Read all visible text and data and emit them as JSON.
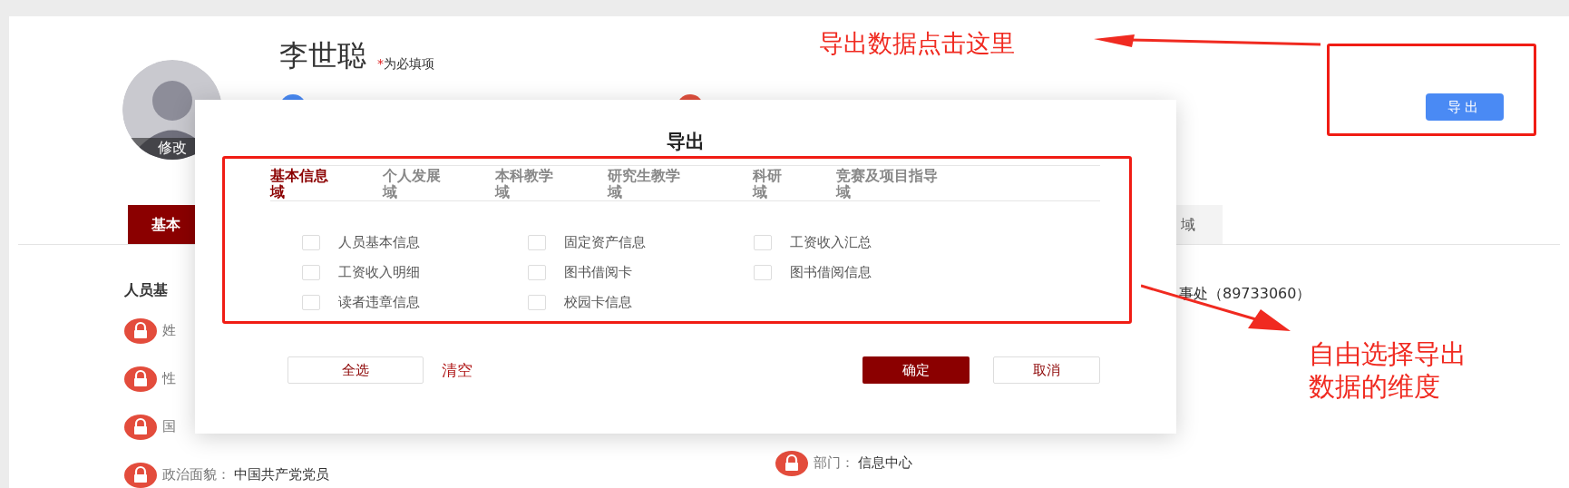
{
  "profile": {
    "name": "李世聪",
    "required_mark": "*",
    "required_note": "为必填项",
    "avatar_action": "修改",
    "export_button": "导出"
  },
  "tabs": [
    {
      "label": "基本",
      "selected": true
    },
    {
      "label": "域",
      "selected": false
    }
  ],
  "section_title": "人员基",
  "left_fields": [
    {
      "label": "姓",
      "locked": true
    },
    {
      "label": "性",
      "locked": true
    },
    {
      "label": "国",
      "locked": true
    },
    {
      "label": "政治面貌：",
      "value": "中国共产党党员",
      "locked": true
    }
  ],
  "right_note": "事处（89733060）",
  "right_fields": [
    {
      "label": "部门：",
      "value": "信息中心",
      "locked": true
    }
  ],
  "dialog": {
    "title": "导出",
    "tabs": [
      {
        "label": "基本信息域",
        "selected": true
      },
      {
        "label": "个人发展域",
        "selected": false
      },
      {
        "label": "本科教学域",
        "selected": false
      },
      {
        "label": "研究生教学域",
        "selected": false
      },
      {
        "label": "科研域",
        "selected": false
      },
      {
        "label": "竞赛及项目指导域",
        "selected": false
      }
    ],
    "options": [
      {
        "label": "人员基本信息",
        "checked": false
      },
      {
        "label": "固定资产信息",
        "checked": false
      },
      {
        "label": "工资收入汇总",
        "checked": false
      },
      {
        "label": "工资收入明细",
        "checked": false
      },
      {
        "label": "图书借阅卡",
        "checked": false
      },
      {
        "label": "图书借阅信息",
        "checked": false
      },
      {
        "label": "读者违章信息",
        "checked": false
      },
      {
        "label": "校园卡信息",
        "checked": false
      }
    ],
    "select_all": "全选",
    "clear": "清空",
    "confirm": "确定",
    "cancel": "取消"
  },
  "annotations": [
    {
      "text": "导出数据点击这里"
    },
    {
      "text": "自由选择导出数据的维度"
    }
  ]
}
